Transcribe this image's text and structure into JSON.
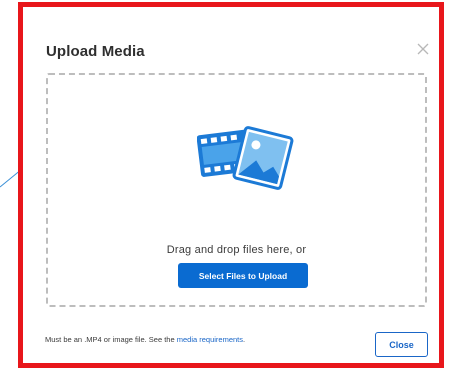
{
  "modal": {
    "title": "Upload Media",
    "close_icon": "close-x-icon",
    "border_color": "#e8161b"
  },
  "dropzone": {
    "icon": "media-film-photo-icon",
    "instruction": "Drag and drop files here, or",
    "select_button_label": "Select Files to Upload",
    "accent_color": "#0a6bd1"
  },
  "footer": {
    "note_prefix": "Must be an .MP4 or image file. See the ",
    "requirements_link": "media requirements",
    "note_suffix": ".",
    "close_button_label": "Close"
  }
}
